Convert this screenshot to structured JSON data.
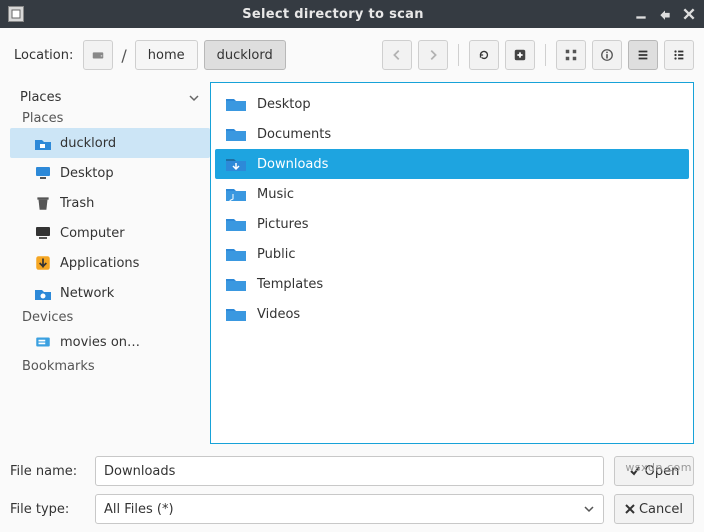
{
  "window": {
    "title": "Select directory to scan"
  },
  "toolbar": {
    "location_label": "Location:",
    "path": {
      "root_icon": "drive",
      "sep": "/",
      "segment1": "home",
      "segment2": "ducklord"
    }
  },
  "sidebar": {
    "header": "Places",
    "group_places": "Places",
    "items_places": [
      {
        "icon": "home-folder",
        "label": "ducklord",
        "selected": true
      },
      {
        "icon": "desktop",
        "label": "Desktop"
      },
      {
        "icon": "trash",
        "label": "Trash"
      },
      {
        "icon": "computer",
        "label": "Computer"
      },
      {
        "icon": "apps",
        "label": "Applications"
      },
      {
        "icon": "network",
        "label": "Network"
      }
    ],
    "group_devices": "Devices",
    "items_devices": [
      {
        "icon": "drive",
        "label": "movies on…"
      }
    ],
    "group_bookmarks": "Bookmarks"
  },
  "files": [
    {
      "icon": "folder",
      "label": "Desktop"
    },
    {
      "icon": "folder",
      "label": "Documents"
    },
    {
      "icon": "folder",
      "label": "Downloads",
      "selected": true
    },
    {
      "icon": "folder",
      "label": "Music"
    },
    {
      "icon": "folder",
      "label": "Pictures"
    },
    {
      "icon": "folder",
      "label": "Public"
    },
    {
      "icon": "folder",
      "label": "Templates"
    },
    {
      "icon": "folder",
      "label": "Videos"
    }
  ],
  "bottom": {
    "filename_label": "File name:",
    "filename_value": "Downloads",
    "filetype_label": "File type:",
    "filetype_value": "All Files (*)",
    "open_label": "Open",
    "cancel_label": "Cancel"
  },
  "watermark": "wsxdn.com"
}
